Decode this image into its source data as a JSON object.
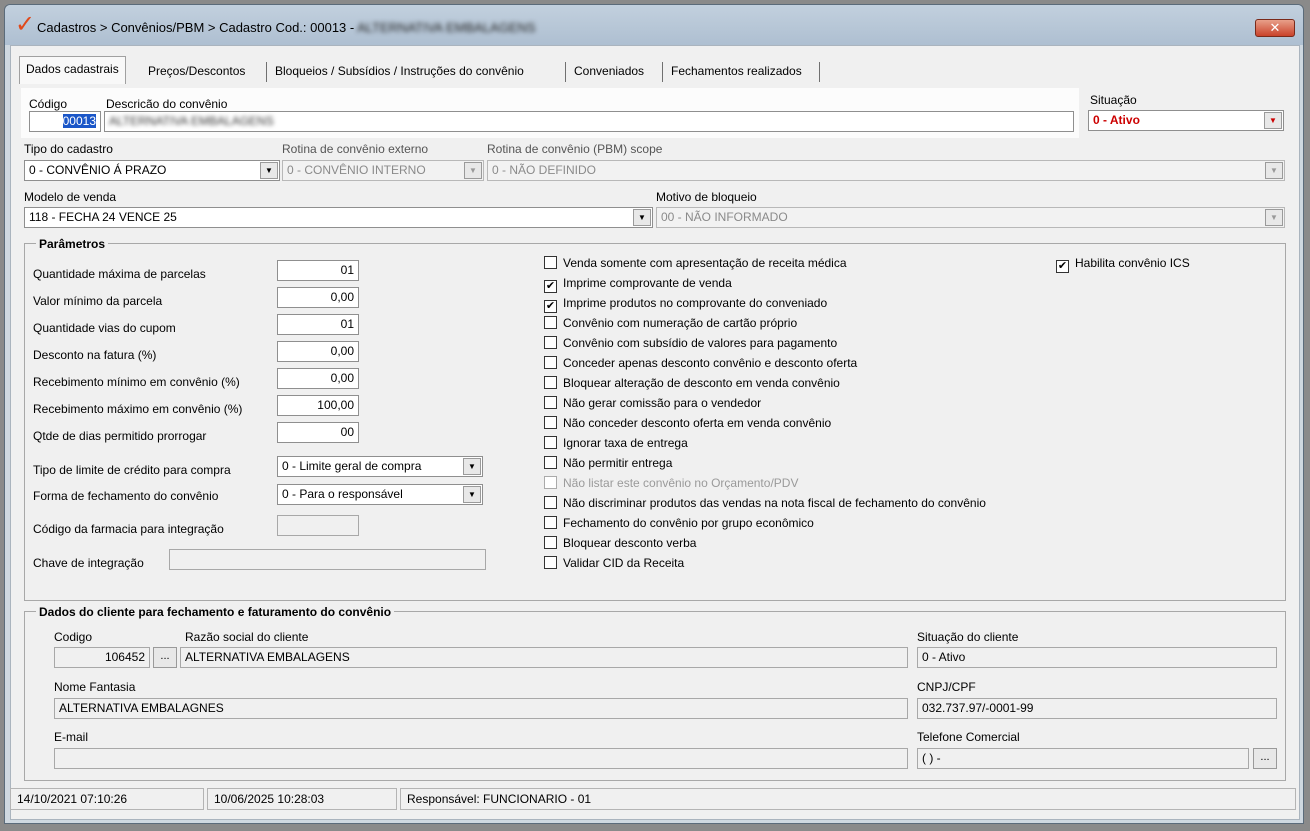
{
  "window": {
    "title_prefix": "Cadastros > Convênios/PBM > Cadastro  Cod.: 00013 - ",
    "title_obscured": "ALTERNATIVA EMBALAGENS",
    "close": "✕"
  },
  "tabs": [
    {
      "label": "Dados cadastrais"
    },
    {
      "label": "Preços/Descontos"
    },
    {
      "label": "Bloqueios / Subsídios / Instruções do convênio"
    },
    {
      "label": "Conveniados"
    },
    {
      "label": "Fechamentos realizados"
    }
  ],
  "header": {
    "codigo_label": "Código",
    "codigo_value": "00013",
    "descricao_label": "Descricão do convênio",
    "descricao_value": "ALTERNATIVA EMBALAGENS",
    "situacao_label": "Situação",
    "situacao_value": "0 - Ativo"
  },
  "row1": {
    "tipo_label": "Tipo do cadastro",
    "tipo_value": "0 - CONVÊNIO Á PRAZO",
    "rotina_ext_label": "Rotina de convênio externo",
    "rotina_ext_value": "0 - CONVÊNIO INTERNO",
    "rotina_pbm_label": "Rotina de convênio (PBM) scope",
    "rotina_pbm_value": "0 - NÃO DEFINIDO"
  },
  "row2": {
    "modelo_label": "Modelo de venda",
    "modelo_value": "118 - FECHA 24 VENCE 25",
    "motivo_label": "Motivo de bloqueio",
    "motivo_value": "00 - NÃO INFORMADO"
  },
  "parametros": {
    "title": "Parâmetros",
    "fields": [
      {
        "label": "Quantidade máxima de parcelas",
        "value": "01"
      },
      {
        "label": "Valor mínimo da parcela",
        "value": "0,00"
      },
      {
        "label": "Quantidade vias do cupom",
        "value": "01"
      },
      {
        "label": "Desconto na fatura (%)",
        "value": "0,00"
      },
      {
        "label": "Recebimento mínimo em convênio (%)",
        "value": "0,00"
      },
      {
        "label": "Recebimento máximo em convênio (%)",
        "value": "100,00"
      },
      {
        "label": "Qtde de dias permitido prorrogar",
        "value": "00"
      }
    ],
    "limite_label": "Tipo de limite de crédito para compra",
    "limite_value": "0 - Limite geral de compra",
    "fechamento_label": "Forma de fechamento do convênio",
    "fechamento_value": "0 - Para o responsável",
    "farmacia_label": "Código da farmacia para integração",
    "farmacia_value": "",
    "chave_label": "Chave de integração",
    "chave_value": "",
    "checkboxes": [
      {
        "label": "Venda somente com apresentação de receita médica",
        "mark": ""
      },
      {
        "label": "Imprime comprovante de venda",
        "mark": "✔"
      },
      {
        "label": "Imprime produtos no comprovante do conveniado",
        "mark": "✔"
      },
      {
        "label": "Convênio com numeração de cartão próprio",
        "mark": ""
      },
      {
        "label": "Convênio com subsídio de valores para pagamento",
        "mark": ""
      },
      {
        "label": "Conceder apenas desconto convênio e desconto oferta",
        "mark": ""
      },
      {
        "label": "Bloquear alteração de desconto em venda convênio",
        "mark": ""
      },
      {
        "label": "Não gerar comissão para o vendedor",
        "mark": ""
      },
      {
        "label": "Não conceder desconto oferta em venda convênio",
        "mark": ""
      },
      {
        "label": "Ignorar taxa de entrega",
        "mark": ""
      },
      {
        "label": "Não permitir entrega",
        "mark": ""
      },
      {
        "label": "Não listar este convênio no Orçamento/PDV",
        "mark": ""
      },
      {
        "label": "Não discriminar produtos das vendas na nota fiscal de fechamento do convênio",
        "mark": ""
      },
      {
        "label": "Fechamento do convênio por grupo econômico",
        "mark": ""
      },
      {
        "label": "Bloquear desconto verba",
        "mark": ""
      },
      {
        "label": "Validar CID da Receita",
        "mark": ""
      }
    ],
    "ics": {
      "label": "Habilita convênio ICS",
      "mark": "✔"
    }
  },
  "cliente": {
    "title": "Dados do cliente para fechamento e faturamento do convênio",
    "codigo_label": "Codigo",
    "codigo_value": "106452",
    "lookup": "...",
    "razao_label": "Razão social do cliente",
    "razao_value": "ALTERNATIVA EMBALAGENS",
    "situacao_label": "Situação do cliente",
    "situacao_value": "0 - Ativo",
    "fantasia_label": "Nome Fantasia",
    "fantasia_value": "ALTERNATIVA EMBALAGNES",
    "cnpj_label": "CNPJ/CPF",
    "cnpj_value": "032.737.97/-0001-99",
    "email_label": "E-mail",
    "email_value": "",
    "telefone_label": "Telefone Comercial",
    "telefone_value": "(  )     -",
    "telefone_btn": "..."
  },
  "statusbar": {
    "created": "14/10/2021 07:10:26",
    "modified": "10/06/2025 10:28:03",
    "responsavel": "Responsável: FUNCIONARIO - 01"
  },
  "icons": {
    "dropdown": "▼",
    "logo": "✓"
  },
  "colors": {
    "situacao_text": "#cc0000",
    "logo": "#e04a1b"
  }
}
